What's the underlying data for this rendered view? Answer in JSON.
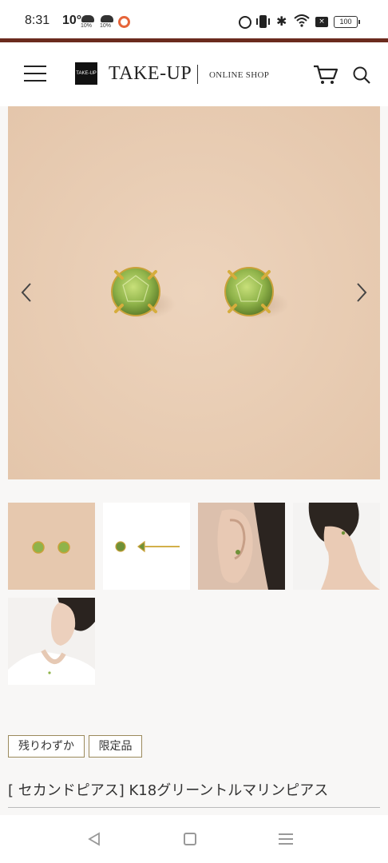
{
  "status_bar": {
    "time": "8:31",
    "temperature": "10°",
    "weather": [
      {
        "icon": "rain-cloud-icon",
        "value": "10%"
      },
      {
        "icon": "rain-cloud-icon",
        "value": "10%"
      }
    ],
    "battery": "100"
  },
  "header": {
    "logo_mark": "TAKE-UP",
    "logo": "TAKE-UP",
    "logo_sub": "ONLINE SHOP",
    "brand_color": "#6b2b1e"
  },
  "product": {
    "badges": [
      "残りわずか",
      "限定品"
    ],
    "title": "[ セカンドピアス] K18グリーントルマリンピアス",
    "gem_color": "#8fb34a",
    "thumbnails": [
      "pair-on-paper",
      "side-view",
      "ear-closeup",
      "ear-profile",
      "model-portrait"
    ],
    "active_thumbnail": 1
  }
}
